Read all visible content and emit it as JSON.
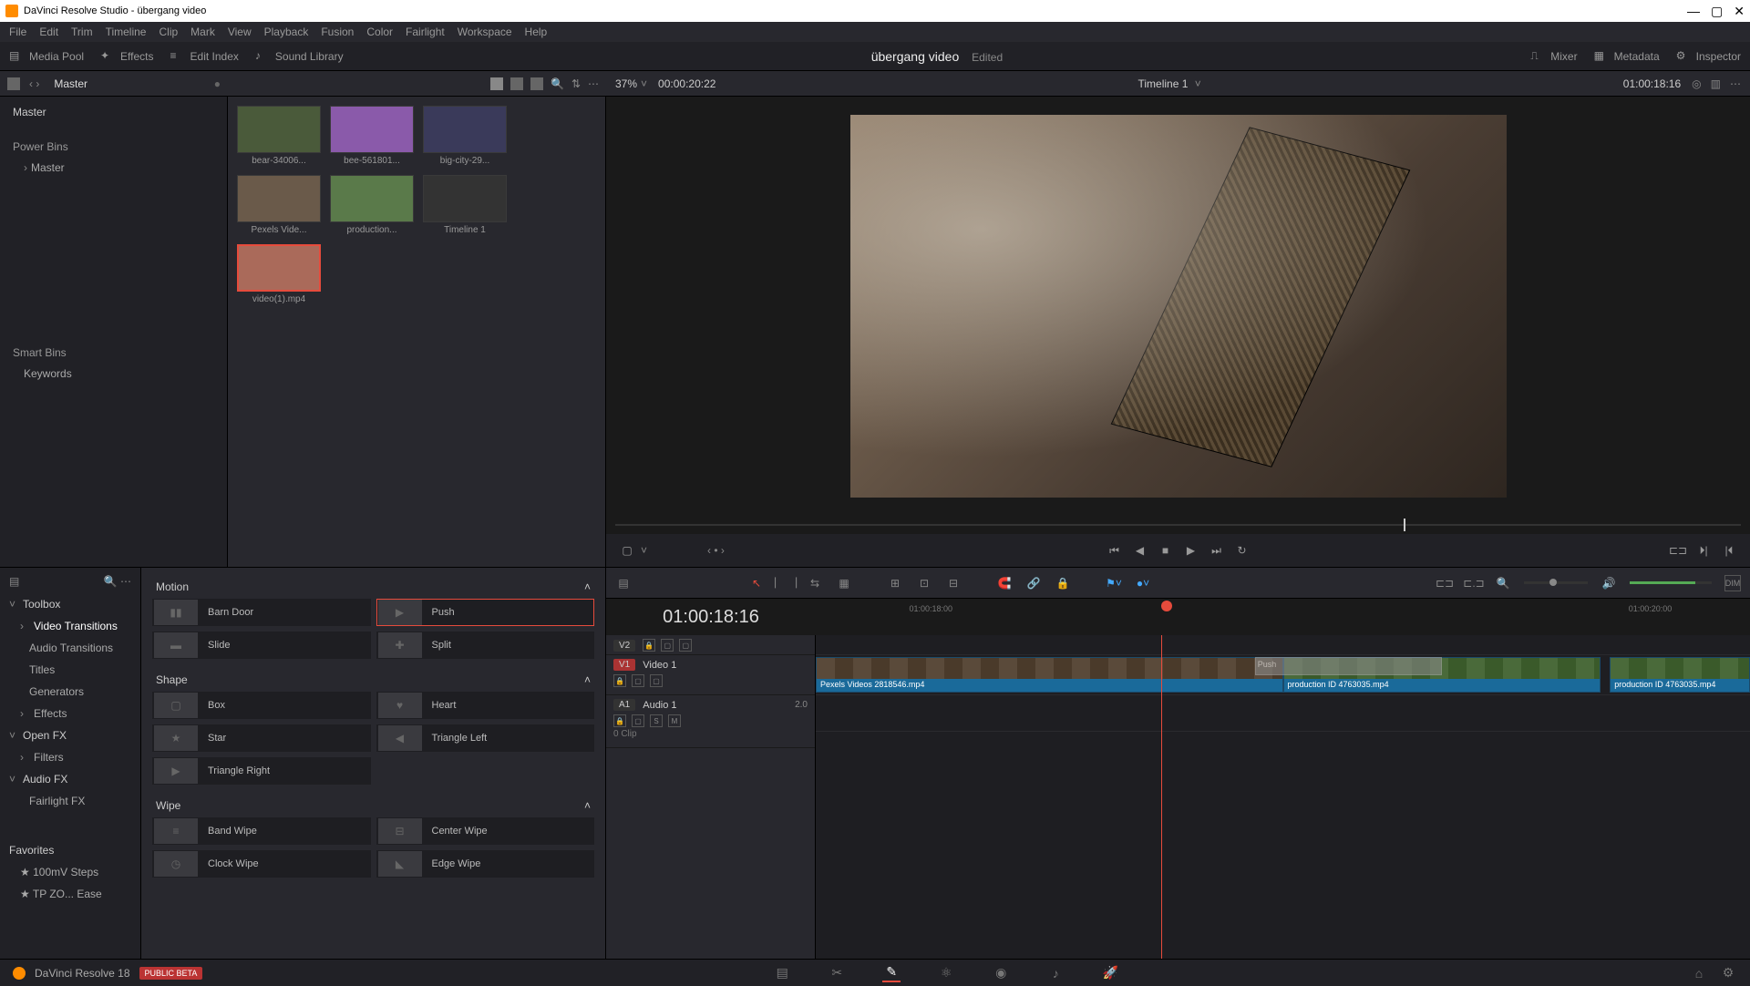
{
  "window": {
    "title": "DaVinci Resolve Studio - übergang video",
    "minimize": "—",
    "maximize": "▢",
    "close": "✕"
  },
  "menubar": [
    "File",
    "Edit",
    "Trim",
    "Timeline",
    "Clip",
    "Mark",
    "View",
    "Playback",
    "Fusion",
    "Color",
    "Fairlight",
    "Workspace",
    "Help"
  ],
  "toolbar": {
    "media_pool": "Media Pool",
    "effects": "Effects",
    "edit_index": "Edit Index",
    "sound_library": "Sound Library",
    "project_title": "übergang video",
    "edited": "Edited",
    "mixer": "Mixer",
    "metadata": "Metadata",
    "inspector": "Inspector"
  },
  "subhead": {
    "breadcrumb": "Master",
    "zoom_pct": "37%",
    "source_tc": "00:00:20:22",
    "timeline_name": "Timeline 1",
    "record_tc": "01:00:18:16"
  },
  "media_browser": {
    "root": "Master",
    "power_bins": "Power Bins",
    "power_child": "Master",
    "smart_bins": "Smart Bins",
    "keywords": "Keywords"
  },
  "thumbs": [
    {
      "label": "bear-34006..."
    },
    {
      "label": "bee-561801..."
    },
    {
      "label": "big-city-29..."
    },
    {
      "label": "Pexels Vide..."
    },
    {
      "label": "production..."
    },
    {
      "label": "Timeline 1"
    },
    {
      "label": "video(1).mp4",
      "selected": true
    }
  ],
  "fx_sidebar": {
    "toolbox": "Toolbox",
    "video_transitions": "Video Transitions",
    "audio_transitions": "Audio Transitions",
    "titles": "Titles",
    "generators": "Generators",
    "effects": "Effects",
    "open_fx": "Open FX",
    "filters": "Filters",
    "audio_fx": "Audio FX",
    "fairlight_fx": "Fairlight FX",
    "favorites": "Favorites",
    "fav1": "100mV Steps",
    "fav2": "TP ZO... Ease"
  },
  "fx_groups": {
    "motion": "Motion",
    "shape": "Shape",
    "wipe": "Wipe"
  },
  "fx_items": {
    "barn_door": "Barn Door",
    "push": "Push",
    "slide": "Slide",
    "split": "Split",
    "box": "Box",
    "heart": "Heart",
    "star": "Star",
    "triangle_left": "Triangle Left",
    "triangle_right": "Triangle Right",
    "band_wipe": "Band Wipe",
    "center_wipe": "Center Wipe",
    "clock_wipe": "Clock Wipe",
    "edge_wipe": "Edge Wipe"
  },
  "timeline": {
    "tc_display": "01:00:18:16",
    "ruler_ticks": [
      {
        "label": "01:00:18:00",
        "pos": "10%"
      },
      {
        "label": "01:00:20:00",
        "pos": "87%"
      }
    ],
    "tracks": {
      "v2": "V2",
      "v1_badge": "V1",
      "v1_name": "Video 1",
      "a1_badge": "A1",
      "a1_name": "Audio 1",
      "a1_gain": "2.0",
      "clip_meta": "0 Clip"
    },
    "clips": [
      {
        "label": "Pexels Videos 2818546.mp4",
        "left": "0%",
        "width": "50%",
        "cls": ""
      },
      {
        "label": "production ID 4763035.mp4",
        "left": "50%",
        "width": "34%",
        "cls": "green"
      },
      {
        "label": "production ID 4763035.mp4",
        "left": "85%",
        "width": "15%",
        "cls": "green"
      }
    ],
    "transition_label": "Push"
  },
  "bottom": {
    "app_name": "DaVinci Resolve 18",
    "badge": "PUBLIC BETA"
  }
}
